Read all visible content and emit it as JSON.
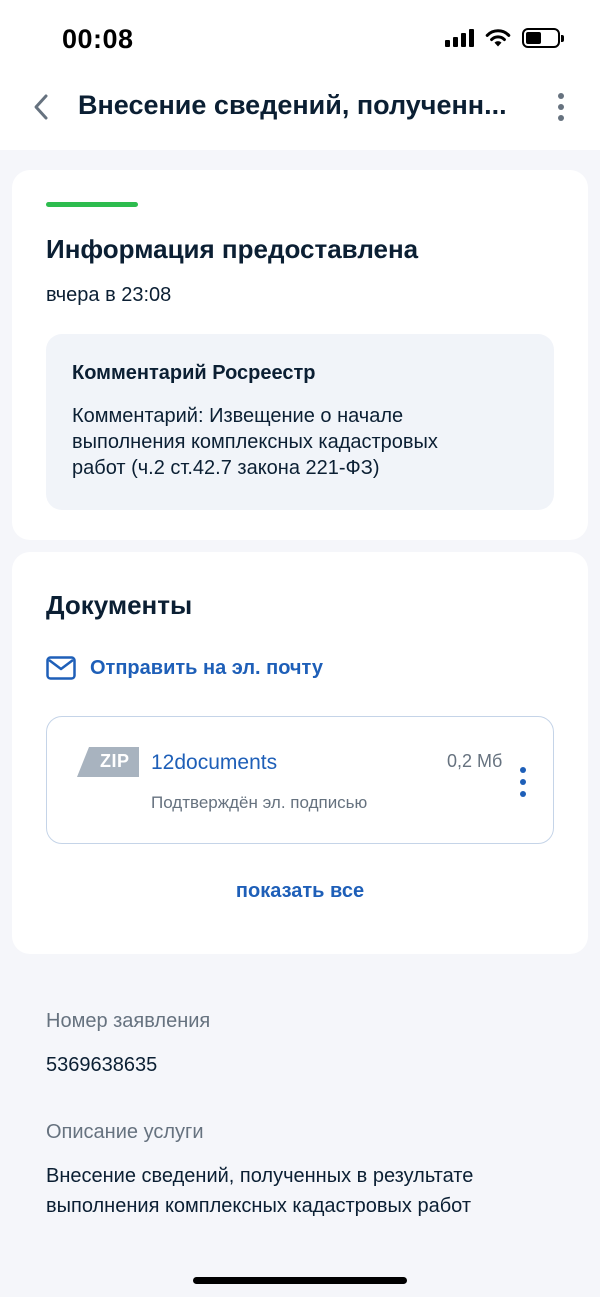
{
  "status_bar": {
    "time": "00:08",
    "icons": [
      "signal-icon",
      "wifi-icon",
      "battery-icon"
    ],
    "battery_level": 0.5
  },
  "nav": {
    "title": "Внесение сведений, полученн...",
    "back_icon": "chevron-left-icon",
    "more_icon": "more-vertical-icon"
  },
  "status_card": {
    "accent_color": "#2dbc4e",
    "title": "Информация предоставлена",
    "time": "вчера в 23:08",
    "comment": {
      "title": "Комментарий Росреестр",
      "text": "Комментарий: Извещение о начале\nвыполнения комплексных кадастровых\nработ (ч.2 ст.42.7  закона 221-ФЗ)"
    }
  },
  "documents_card": {
    "title": "Документы",
    "send_email_label": "Отправить на эл. почту",
    "files": [
      {
        "type_badge": "ZIP",
        "name": "12documents",
        "size": "0,2 Мб",
        "signature": "Подтверждён эл. подписью"
      }
    ],
    "show_all_label": "показать все"
  },
  "info": {
    "application_number_label": "Номер заявления",
    "application_number": "5369638635",
    "service_description_label": "Описание услуги",
    "service_description": "Внесение сведений, полученных в результате\nвыполнения комплексных кадастровых работ"
  },
  "colors": {
    "link": "#1e5fb8",
    "text_primary": "#0b1f33",
    "text_secondary": "#66727f",
    "success": "#2dbc4e",
    "background": "#f5f6fa"
  }
}
